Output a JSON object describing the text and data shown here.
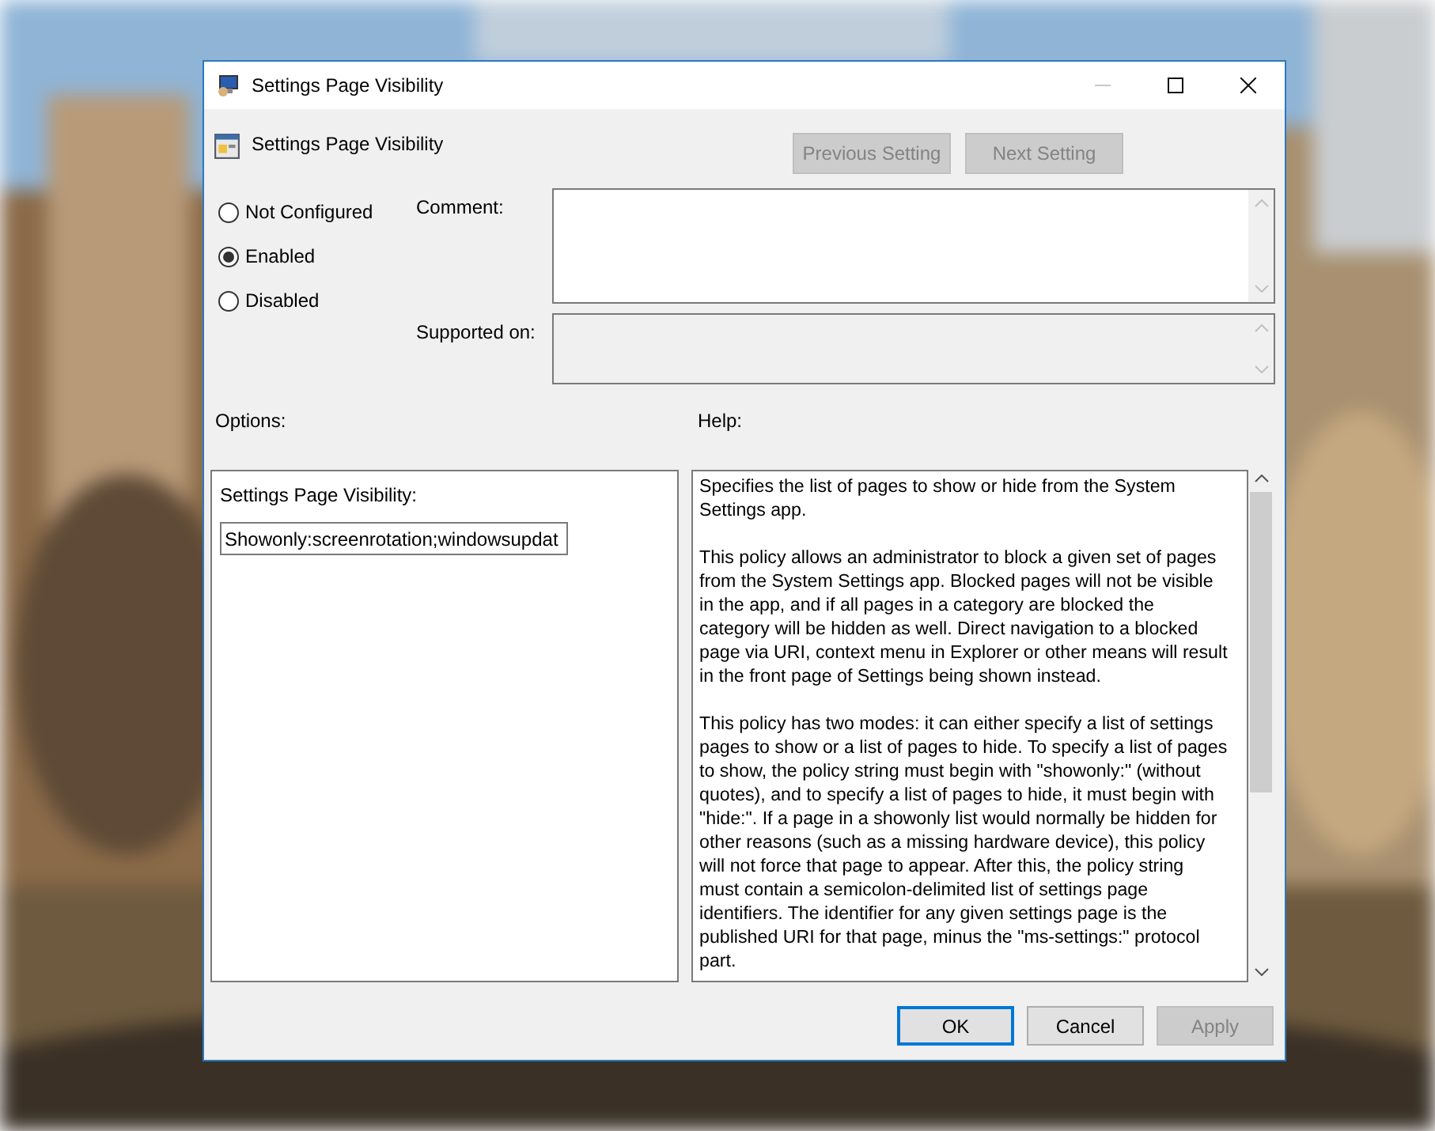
{
  "window": {
    "title": "Settings Page Visibility"
  },
  "header": {
    "title": "Settings Page Visibility",
    "buttons": [
      {
        "label": "Previous Setting",
        "disabled": true
      },
      {
        "label": "Next Setting",
        "disabled": true
      }
    ]
  },
  "state_options": [
    {
      "label": "Not Configured",
      "selected": false
    },
    {
      "label": "Enabled",
      "selected": true
    },
    {
      "label": "Disabled",
      "selected": false
    }
  ],
  "comment": {
    "label": "Comment:"
  },
  "supported_on": {
    "label": "Supported on:"
  },
  "options": {
    "label": "Options:",
    "field_label": "Settings Page Visibility:",
    "value": "Showonly:screenrotation;windowsupdat"
  },
  "help": {
    "label": "Help:",
    "paragraphs": [
      "Specifies the list of pages to show or hide from the System Settings app.",
      "This policy allows an administrator to block a given set of pages from the System Settings app. Blocked pages will not be visible in the app, and if all pages in a category are blocked the category will be hidden as well. Direct navigation to a blocked page via URI, context menu in Explorer or other means will result in the front page of Settings being shown instead.",
      "This policy has two modes: it can either specify a list of settings pages to show or a list of pages to hide. To specify a list of pages to show, the policy string must begin with \"showonly:\" (without quotes), and to specify a list of pages to hide, it must begin with \"hide:\". If a page in a showonly list would normally be hidden for other reasons (such as a missing hardware device), this policy will not force that page to appear. After this, the policy string must contain a semicolon-delimited list of settings page identifiers. The identifier for any given settings page is the published URI for that page, minus the \"ms-settings:\" protocol part."
    ]
  },
  "footer_buttons": [
    {
      "label": "OK",
      "disabled": false,
      "selected": true
    },
    {
      "label": "Cancel",
      "disabled": false,
      "selected": false
    },
    {
      "label": "Apply",
      "disabled": true,
      "selected": false
    }
  ]
}
